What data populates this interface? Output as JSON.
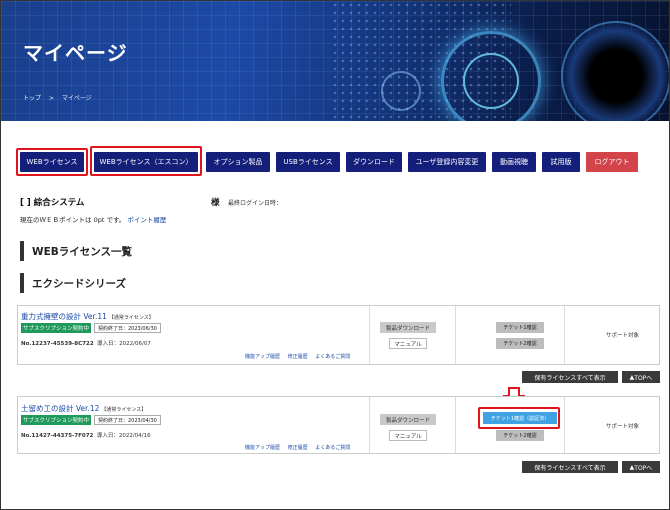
{
  "hero": {
    "title": "マイページ",
    "breadcrumb": [
      "トップ",
      ">",
      "マイページ"
    ]
  },
  "nav": {
    "web_license": "WEBライセンス",
    "web_license_escon": "WEBライセンス（エスコン）",
    "options": "オプション製品",
    "usb": "USBライセンス",
    "download": "ダウンロード",
    "user_change": "ユーザ登録内容変更",
    "video": "動画視聴",
    "trial": "試用版",
    "logout": "ログアウト"
  },
  "user": {
    "company": "[ ] 綜合システム",
    "sama": "様",
    "last_login": "最終ログイン日時：",
    "points": "現在のＷＥＢポイントは 0pt です。",
    "points_link": "ポイント履歴"
  },
  "sections": {
    "web_list": "WEBライセンス一覧",
    "series": "エクシードシリーズ"
  },
  "products": [
    {
      "title": "重力式擁壁の設計 Ver.11",
      "type": "【通常ライセンス】",
      "status": "サブスクリプション契約中",
      "end": "契約終了日：2023/06/30",
      "no": "No.12237-45539-8C722",
      "date": "導入日：2022/06/07",
      "links": [
        "機能アップ履歴",
        "修正履歴",
        "よくあるご質問"
      ],
      "download": "製品ダウンロード",
      "manual": "マニュアル",
      "ticket1": "チケット1確認",
      "ticket2": "チケット2確認",
      "support": "サポート対象"
    },
    {
      "title": "土留め工の設計 Ver.12",
      "type": "【通常ライセンス】",
      "status": "サブスクリプション契約中",
      "end": "契約終了日：2023/04/30",
      "no": "No.11427-44375-7F072",
      "date": "導入日：2022/04/16",
      "links": [
        "機能アップ履歴",
        "修正履歴",
        "よくあるご質問"
      ],
      "download": "製品ダウンロード",
      "manual": "マニュアル",
      "ticket1": "チケット1確認（認証済）",
      "ticket2": "チケット2確認",
      "support": "サポート対象"
    }
  ],
  "footer_buttons": {
    "show_all": "保有ライセンスすべて表示",
    "top": "TOPへ"
  },
  "colors": {
    "nav": "#141f7a",
    "logout": "#d3434a",
    "highlight": "#e0141e",
    "subscription": "#1f9a5a",
    "ticket_active": "#3fa3e3"
  }
}
